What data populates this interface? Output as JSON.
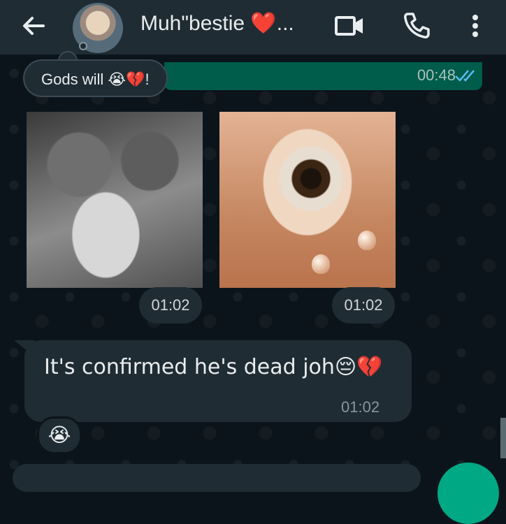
{
  "header": {
    "contact_name": "Muh\"bestie ❤️...",
    "icons": [
      "back-arrow-icon",
      "video-call-icon",
      "voice-call-icon",
      "more-options-icon"
    ]
  },
  "outgoing": {
    "quoted_reply": "Gods will 😭💔!",
    "time": "00:48"
  },
  "photos": [
    {
      "time": "01:02"
    },
    {
      "time": "01:02"
    }
  ],
  "incoming_message": {
    "text": "It's confirmed he's dead joh😔💔",
    "time": "01:02",
    "reaction": "😭"
  },
  "colors": {
    "header_bg": "#1f2c33",
    "chat_bg": "#0b141a",
    "outgoing_bubble": "#005c4b",
    "incoming_bubble": "#1f2c33",
    "accent": "#00a884",
    "read_ticks": "#53bdeb"
  }
}
